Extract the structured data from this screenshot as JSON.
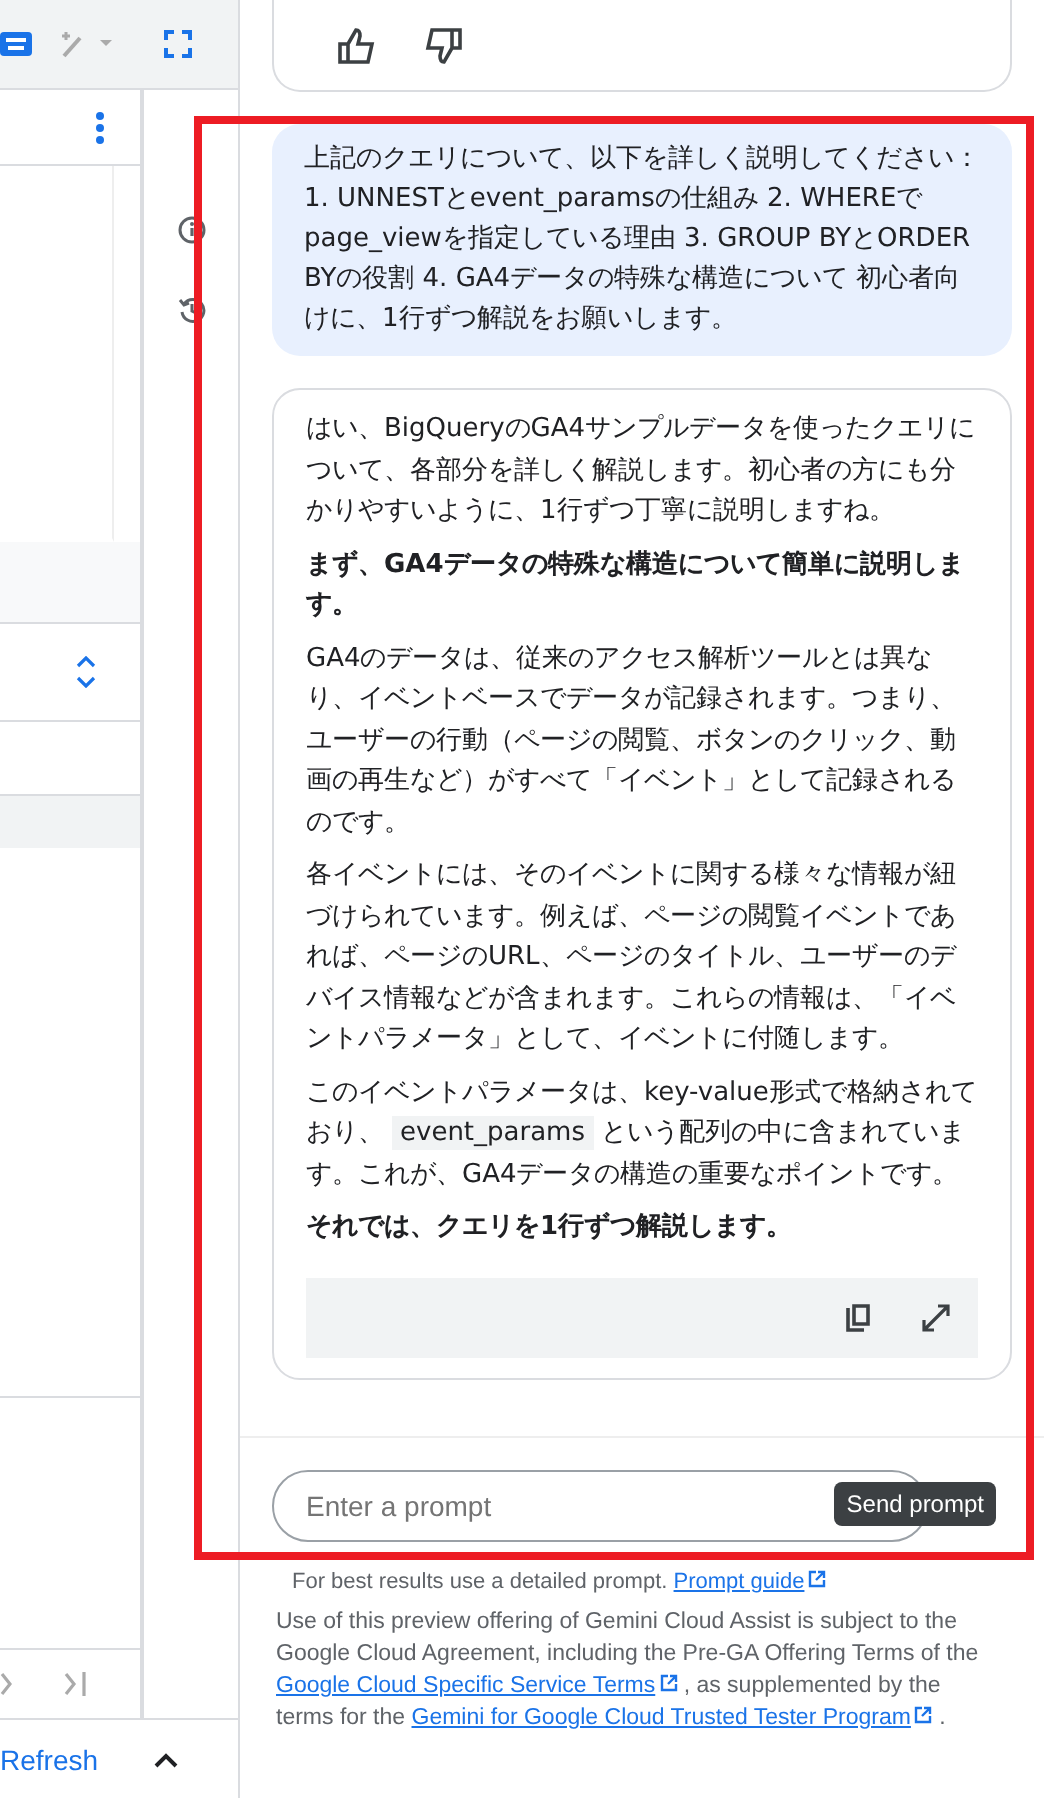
{
  "left_panel": {
    "refresh_link": "Refresh"
  },
  "chat": {
    "user_message": "上記のクエリについて、以下を詳しく説明してください： 1. UNNESTとevent_paramsの仕組み 2. WHEREでpage_viewを指定している理由 3. GROUP BYとORDER BYの役割 4. GA4データの特殊な構造について 初心者向けに、1行ずつ解説をお願いします。",
    "response": [
      {
        "kind": "plain",
        "parts": [
          {
            "kind": "text",
            "text": "はい、BigQueryのGA4サンプルデータを使ったクエリについて、各部分を詳しく解説します。初心者の方にも分かりやすいように、1行ずつ丁寧に説明しますね。"
          }
        ]
      },
      {
        "kind": "bold",
        "parts": [
          {
            "kind": "text",
            "text": "まず、GA4データの特殊な構造について簡単に説明します。"
          }
        ]
      },
      {
        "kind": "plain",
        "parts": [
          {
            "kind": "text",
            "text": "GA4のデータは、従来のアクセス解析ツールとは異なり、イベントベースでデータが記録されます。つまり、ユーザーの行動（ページの閲覧、ボタンのクリック、動画の再生など）がすべて「イベント」として記録されるのです。"
          }
        ]
      },
      {
        "kind": "plain",
        "parts": [
          {
            "kind": "text",
            "text": "各イベントには、そのイベントに関する様々な情報が紐づけられています。例えば、ページの閲覧イベントであれば、ページのURL、ページのタイトル、ユーザーのデバイス情報などが含まれます。これらの情報は、「イベントパラメータ」として、イベントに付随します。"
          }
        ]
      },
      {
        "kind": "plain",
        "parts": [
          {
            "kind": "text",
            "text": "このイベントパラメータは、key-value形式で格納されており、"
          },
          {
            "kind": "code",
            "text": "event_params"
          },
          {
            "kind": "text",
            "text": "という配列の中に含まれています。これが、GA4データの構造の重要なポイントです。"
          }
        ]
      },
      {
        "kind": "bold",
        "parts": [
          {
            "kind": "text",
            "text": "それでは、クエリを1行ずつ解説します。"
          }
        ]
      }
    ],
    "prompt": {
      "placeholder": "Enter a prompt"
    },
    "tooltip": "Send prompt",
    "hint": {
      "text": "For best results use a detailed prompt.",
      "link": "Prompt guide"
    },
    "disclaimer": [
      {
        "kind": "text",
        "text": "Use of this preview offering of Gemini Cloud Assist is subject to the Google Cloud Agreement, including the Pre-GA Offering Terms of the"
      },
      {
        "kind": "link",
        "text": "Google Cloud Specific Service Terms"
      },
      {
        "kind": "text",
        "text": ", as supplemented by the terms for the"
      },
      {
        "kind": "link",
        "text": "Gemini for Google Cloud Trusted Tester Program"
      },
      {
        "kind": "text",
        "text": "."
      }
    ]
  }
}
